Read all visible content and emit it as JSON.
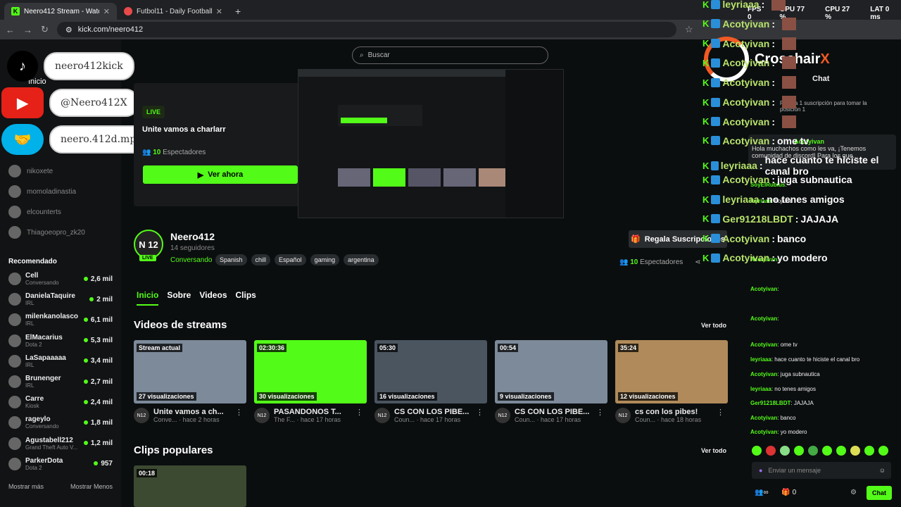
{
  "browser": {
    "tabs": [
      {
        "title": "Neero412 Stream - Watch Live",
        "active": true
      },
      {
        "title": "Futbol11 - Daily Football Game",
        "active": false
      }
    ],
    "url": "kick.com/neero412"
  },
  "search": {
    "placeholder": "Buscar"
  },
  "socials": [
    {
      "label": "neero412kick",
      "icon": "tiktok-icon",
      "color": "#000000"
    },
    {
      "label": "@Neero412X",
      "icon": "youtube-icon",
      "color": "#ff0000"
    },
    {
      "label": "neero.412d.mp",
      "icon": "mercadopago-icon",
      "color": "#00b1ea"
    }
  ],
  "sidebar": {
    "start_label": "Inicio",
    "followed": [
      "nikoxete",
      "momoladinastia",
      "elcounterts",
      "Thiagoeopro_zk20"
    ],
    "recommended_title": "Recomendado",
    "recommended": [
      {
        "name": "Cell",
        "category": "Conversando",
        "viewers": "2,6 mil"
      },
      {
        "name": "DanielaTaquire",
        "category": "IRL",
        "viewers": "2 mil"
      },
      {
        "name": "milenkanolasco",
        "category": "IRL",
        "viewers": "6,1 mil"
      },
      {
        "name": "ElMacarius",
        "category": "Dota 2",
        "viewers": "5,3 mil"
      },
      {
        "name": "LaSapaaaaa",
        "category": "IRL",
        "viewers": "3,4 mil"
      },
      {
        "name": "Brunenger",
        "category": "IRL",
        "viewers": "2,7 mil"
      },
      {
        "name": "Carre",
        "category": "Kiosk",
        "viewers": "2,4 mil"
      },
      {
        "name": "rageylo",
        "category": "Conversando",
        "viewers": "1,8 mil"
      },
      {
        "name": "Agustabell212",
        "category": "Grand Theft Auto V...",
        "viewers": "1,2 mil"
      },
      {
        "name": "ParkerDota",
        "category": "Dota 2",
        "viewers": "957"
      }
    ],
    "show_more": "Mostrar más",
    "show_less": "Mostrar Menos"
  },
  "live_card": {
    "badge": "LIVE",
    "title": "Unite vamos a charlarr",
    "viewers_count": "10",
    "viewers_label": "Espectadores",
    "watch_button": "Ver ahora"
  },
  "channel": {
    "avatar_text": "N 12",
    "live_badge": "LIVE",
    "name": "Neero412",
    "followers": "14 seguidores",
    "category": "Conversando",
    "tags": [
      "Spanish",
      "chill",
      "Español",
      "gaming",
      "argentina"
    ],
    "gift_button": "Regala Suscripciones",
    "viewers_count": "10",
    "viewers_label": "Espectadores",
    "tabs": [
      "Inicio",
      "Sobre",
      "Videos",
      "Clips"
    ]
  },
  "videos": {
    "title": "Videos de streams",
    "see_all": "Ver todo",
    "items": [
      {
        "duration": "Stream actual",
        "views": "27 visualizaciones",
        "title": "Unite vamos a ch...",
        "category": "Conve...",
        "age": "hace 2 horas",
        "thumb_color": "#7c8a9a"
      },
      {
        "duration": "02:30:36",
        "views": "30 visualizaciones",
        "title": "PASANDONOS T...",
        "category": "The F...",
        "age": "hace 17 horas",
        "thumb_color": "#53fc18"
      },
      {
        "duration": "05:30",
        "views": "16 visualizaciones",
        "title": "CS CON LOS PIBE...",
        "category": "Coun...",
        "age": "hace 17 horas",
        "thumb_color": "#4a5560"
      },
      {
        "duration": "00:54",
        "views": "9 visualizaciones",
        "title": "CS CON LOS PIBE...",
        "category": "Coun...",
        "age": "hace 17 horas",
        "thumb_color": "#7c8a9a"
      },
      {
        "duration": "35:24",
        "views": "12 visualizaciones",
        "title": "cs con los pibes!",
        "category": "Coun...",
        "age": "hace 18 horas",
        "thumb_color": "#b08a5a"
      }
    ]
  },
  "clips": {
    "title": "Clips populares",
    "see_all": "Ver todo",
    "first_duration": "00:18"
  },
  "hud": {
    "fps": "0",
    "gpu": "77 %",
    "cpu": "27 %",
    "lat": "0 ms"
  },
  "overlay_chat": [
    {
      "user": "leyriaaa",
      "msg": "",
      "color": "#b7e36b"
    },
    {
      "user": "Acotyivan",
      "msg": "",
      "color": "#b7e36b"
    },
    {
      "user": "Acotyivan",
      "msg": "",
      "color": "#b7e36b"
    },
    {
      "user": "Acotyivan",
      "msg": "",
      "color": "#b7e36b"
    },
    {
      "user": "Acotyivan",
      "msg": "",
      "color": "#b7e36b"
    },
    {
      "user": "Acotyivan",
      "msg": "",
      "color": "#b7e36b"
    },
    {
      "user": "Acotyivan",
      "msg": "",
      "color": "#b7e36b"
    },
    {
      "user": "Acotyivan",
      "msg": "ome tv",
      "color": "#b7e36b"
    },
    {
      "user": "leyriaaa",
      "msg": "hace cuanto te hiciste el canal bro",
      "color": "#b7e36b"
    },
    {
      "user": "Acotyivan",
      "msg": "juga subnautica",
      "color": "#b7e36b"
    },
    {
      "user": "leyriaaa",
      "msg": "no tenes amigos",
      "color": "#b7e36b"
    },
    {
      "user": "Ger91218LBDT",
      "msg": "JAJAJA",
      "color": "#b7e36b"
    },
    {
      "user": "Acotyivan",
      "msg": "banco",
      "color": "#b7e36b"
    },
    {
      "user": "Acotyivan",
      "msg": "yo modero",
      "color": "#b7e36b"
    }
  ],
  "crosshair": {
    "text": "Crosshair",
    "x": "X"
  },
  "chat": {
    "title": "Chat",
    "sub_goal": "Regala 1 suscripción para tomar la posición 1",
    "pinned_user": "Acotyivan",
    "pinned_msg": "Hola muchachos como les va, ¡Tenemos comunidad de discord! Para los que...",
    "messages": [
      {
        "user": "SoyElRubius",
        "msg": ""
      },
      {
        "user": "leyriaaa",
        "msg": "hojlund"
      },
      {
        "user": "Acotyivan",
        "msg": ""
      },
      {
        "user": "Acotyivan",
        "msg": ""
      },
      {
        "user": "Acotyivan",
        "msg": ""
      },
      {
        "user": "Acotyivan",
        "msg": "ome tv"
      },
      {
        "user": "leyriaaa",
        "msg": "hace cuanto te hiciste el canal bro"
      },
      {
        "user": "Acotyivan",
        "msg": "juga subnautica"
      },
      {
        "user": "leyriaaa",
        "msg": "no tenes amigos"
      },
      {
        "user": "Ger91218LBDT",
        "msg": "JAJAJA"
      },
      {
        "user": "Acotyivan",
        "msg": "banco"
      },
      {
        "user": "Acotyivan",
        "msg": "yo modero"
      }
    ],
    "input_placeholder": "Enviar un mensaje",
    "points": "0",
    "send_button": "Chat"
  },
  "colors": {
    "accent": "#53fc18",
    "bg": "#0b0e0f"
  }
}
